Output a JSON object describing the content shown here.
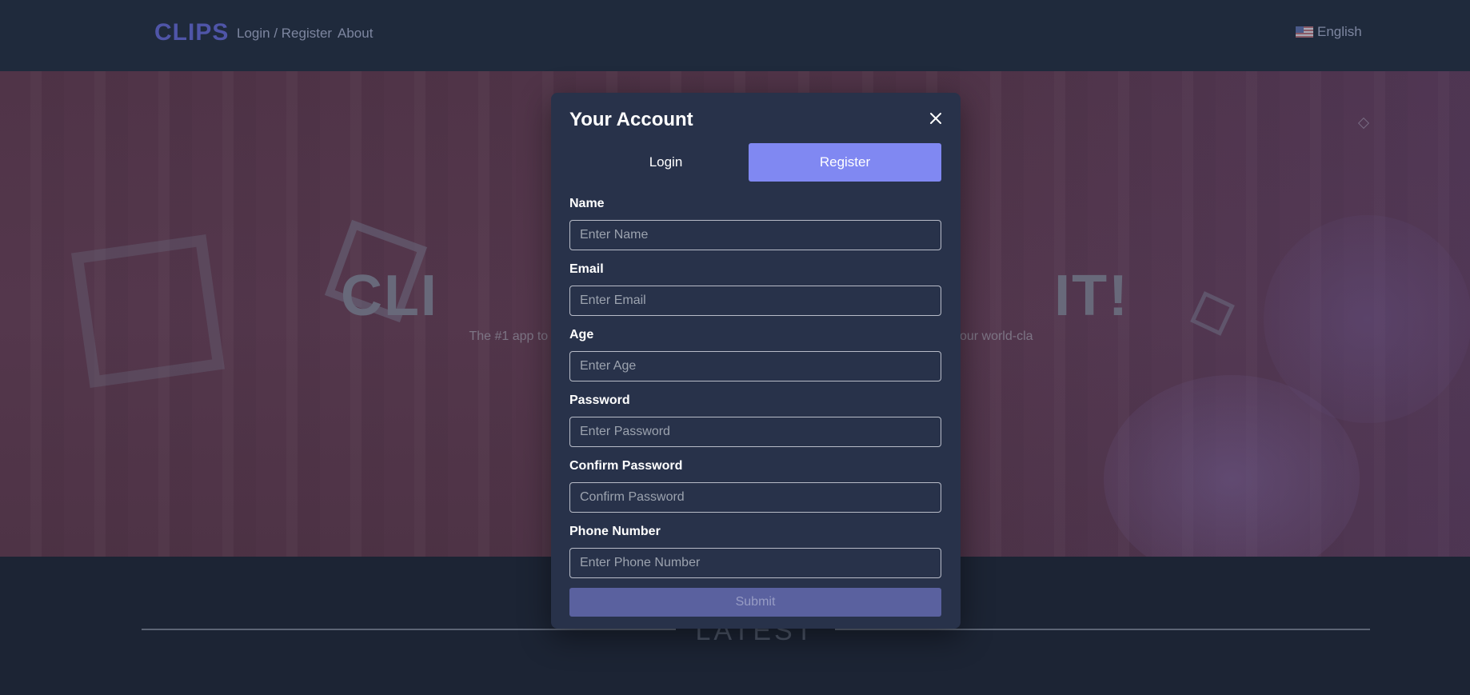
{
  "navbar": {
    "brand": "CLIPS",
    "links": [
      {
        "label": "Login / Register"
      },
      {
        "label": "About"
      }
    ],
    "language": {
      "label": "English",
      "flag_icon": "us-flag-icon"
    }
  },
  "hero": {
    "title": "CLI                                   IT!",
    "subtitle": "The #1 app to watch, cl                                                                                  world! With our world-cla                                                                                          ay!"
  },
  "latest": {
    "title": "LATEST"
  },
  "modal": {
    "title": "Your Account",
    "close_icon": "close-icon",
    "tabs": [
      {
        "label": "Login",
        "active": false
      },
      {
        "label": "Register",
        "active": true
      }
    ],
    "fields": [
      {
        "label": "Name",
        "placeholder": "Enter Name",
        "value": ""
      },
      {
        "label": "Email",
        "placeholder": "Enter Email",
        "value": ""
      },
      {
        "label": "Age",
        "placeholder": "Enter Age",
        "value": ""
      },
      {
        "label": "Password",
        "placeholder": "Enter Password",
        "value": ""
      },
      {
        "label": "Confirm Password",
        "placeholder": "Confirm Password",
        "value": ""
      },
      {
        "label": "Phone Number",
        "placeholder": "Enter Phone Number",
        "value": ""
      }
    ],
    "submit_label": "Submit"
  },
  "colors": {
    "page_bg": "#1c2434",
    "navbar_bg": "#1f2a3c",
    "brand": "#4f55a8",
    "modal_bg": "#28324a",
    "accent": "#8088f2",
    "submit_bg": "#5a619f"
  }
}
